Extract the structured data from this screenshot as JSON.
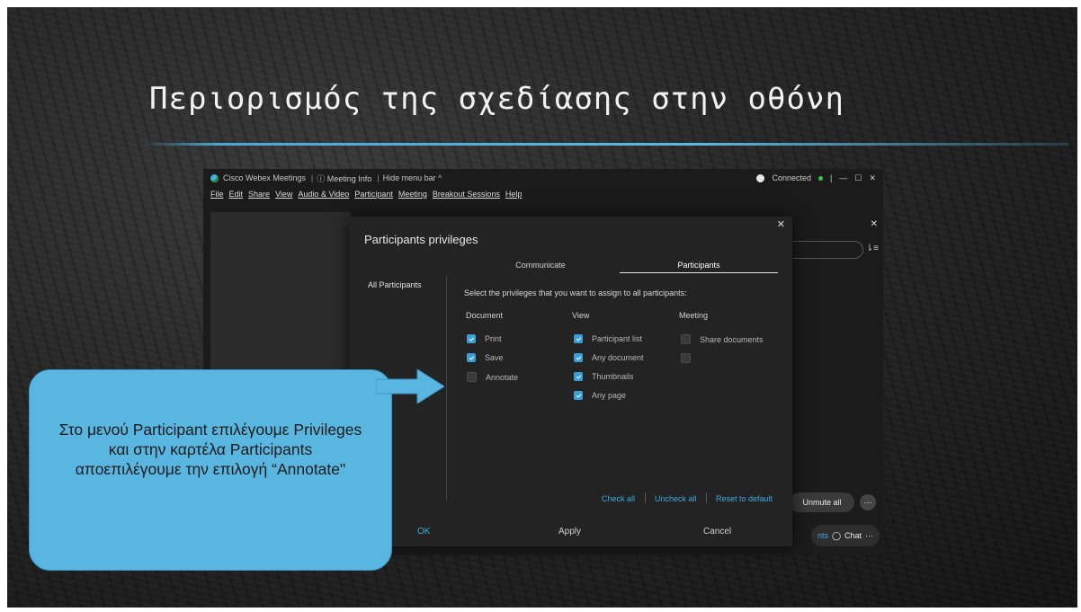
{
  "slide": {
    "title": "Περιορισμός της σχεδίασης στην οθόνη",
    "callout_text": "Στο μενού Participant επιλέγουμε Privileges και στην καρτέλα Participants αποεπιλέγουμε την επιλογή “Annotate\""
  },
  "app": {
    "title": "Cisco Webex Meetings",
    "meeting_info": "Meeting Info",
    "hide_menu_bar": "Hide menu bar ^",
    "status": "Connected",
    "menu": [
      "File",
      "Edit",
      "Share",
      "View",
      "Audio & Video",
      "Participant",
      "Meeting",
      "Breakout Sessions",
      "Help"
    ],
    "unmute_all": "Unmute all",
    "participants_tab_partial": "nts",
    "chat": "Chat"
  },
  "dialog": {
    "title": "Participants privileges",
    "tabs": [
      {
        "label": "Communicate",
        "active": false
      },
      {
        "label": "Participants",
        "active": true
      }
    ],
    "sidebar_item": "All Participants",
    "instruction": "Select the privileges that you want to assign to all participants:",
    "columns": [
      {
        "heading": "Document",
        "items": [
          {
            "label": "Print",
            "checked": true
          },
          {
            "label": "Save",
            "checked": true
          },
          {
            "label": "Annotate",
            "checked": false
          }
        ]
      },
      {
        "heading": "View",
        "items": [
          {
            "label": "Participant list",
            "checked": true
          },
          {
            "label": "Any document",
            "checked": true
          },
          {
            "label": "Thumbnails",
            "checked": true
          },
          {
            "label": "Any page",
            "checked": true
          }
        ]
      },
      {
        "heading": "Meeting",
        "items": [
          {
            "label": "Share documents",
            "checked": false
          },
          {
            "label": "",
            "checked": false
          }
        ]
      }
    ],
    "links": {
      "check_all": "Check all",
      "uncheck_all": "Uncheck all",
      "reset": "Reset to default"
    },
    "buttons": {
      "ok": "OK",
      "apply": "Apply",
      "cancel": "Cancel"
    }
  },
  "colors": {
    "accent": "#3a9fd8",
    "callout": "#59b6e0",
    "title_rule": "#5bb7e0",
    "ok_text": "#3da8e0"
  }
}
